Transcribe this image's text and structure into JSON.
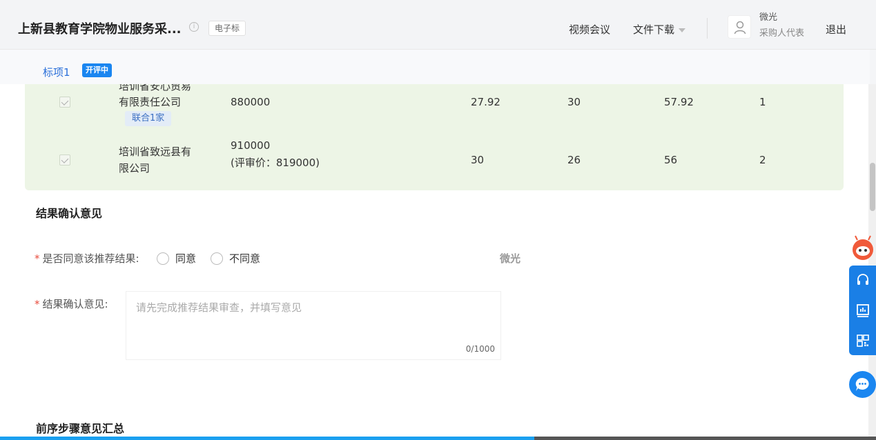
{
  "header": {
    "title": "上新县教育学院物业服务采...",
    "tag": "电子标",
    "nav": {
      "video_meeting": "视频会议",
      "file_download": "文件下载"
    },
    "user": {
      "name": "微光",
      "role": "采购人代表"
    },
    "logout": "退出"
  },
  "tabs": [
    {
      "label": "标项1",
      "badge": "开评中"
    }
  ],
  "results_table": {
    "rows": [
      {
        "company_line1": "培训省安心贸易",
        "company_line2": "有限责任公司",
        "union_tag": "联合1家",
        "price": "880000",
        "price_note": "",
        "score_a": "27.92",
        "score_b": "30",
        "total": "57.92",
        "rank": "1"
      },
      {
        "company_line1": "培训省致远县有",
        "company_line2": "限公司",
        "union_tag": "",
        "price": "910000",
        "price_note": "(评审价：819000)",
        "score_a": "30",
        "score_b": "26",
        "total": "56",
        "rank": "2"
      }
    ]
  },
  "confirm_section": {
    "title": "结果确认意见",
    "agree_label": "是否同意该推荐结果:",
    "options": [
      "同意",
      "不同意"
    ],
    "watermark": "微光",
    "opinion_label": "结果确认意见:",
    "opinion_placeholder": "请先完成推荐结果审查，并填写意见",
    "counter_current": "0",
    "counter_max": "/1000"
  },
  "summary_section": {
    "title": "前序步骤意见汇总"
  },
  "progress": {
    "fraction": 0.61
  },
  "colors": {
    "accent": "#1a86f0",
    "row_bg": "#edf5e6",
    "required": "#e84c3d"
  }
}
